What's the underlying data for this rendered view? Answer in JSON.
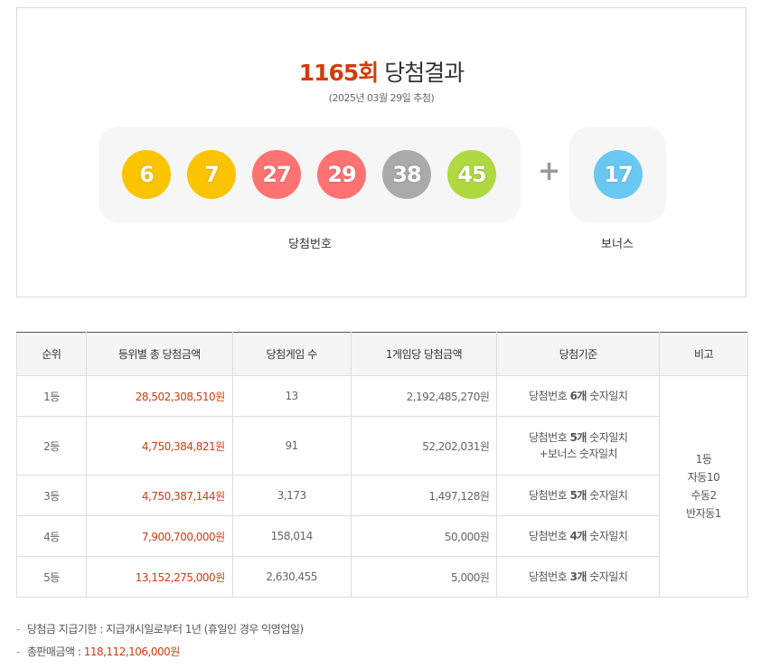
{
  "header": {
    "round": "1165회",
    "title": "당첨결과",
    "date": "(2025년 03월 29일 추첨)"
  },
  "win_numbers": [
    {
      "value": "6",
      "color": "#fbc400"
    },
    {
      "value": "7",
      "color": "#fbc400"
    },
    {
      "value": "27",
      "color": "#ff7272"
    },
    {
      "value": "29",
      "color": "#ff7272"
    },
    {
      "value": "38",
      "color": "#aaaaaa"
    },
    {
      "value": "45",
      "color": "#b0d840"
    }
  ],
  "plus_symbol": "+",
  "bonus_number": {
    "value": "17",
    "color": "#69c8f2"
  },
  "labels": {
    "win_numbers": "당첨번호",
    "bonus": "보너스"
  },
  "table": {
    "headers": [
      "순위",
      "등위별 총 당첨금액",
      "당첨게임 수",
      "1게임당 당첨금액",
      "당첨기준",
      "비고"
    ],
    "rows": [
      {
        "rank": "1등",
        "total": "28,502,308,510원",
        "games": "13",
        "per_game": "2,192,485,270원",
        "criteria_prefix": "당첨번호 ",
        "criteria_bold": "6개",
        "criteria_suffix": " 숫자일치",
        "criteria_line2": ""
      },
      {
        "rank": "2등",
        "total": "4,750,384,821원",
        "games": "91",
        "per_game": "52,202,031원",
        "criteria_prefix": "당첨번호 ",
        "criteria_bold": "5개",
        "criteria_suffix": " 숫자일치",
        "criteria_line2": "+보너스 숫자일치"
      },
      {
        "rank": "3등",
        "total": "4,750,387,144원",
        "games": "3,173",
        "per_game": "1,497,128원",
        "criteria_prefix": "당첨번호 ",
        "criteria_bold": "5개",
        "criteria_suffix": " 숫자일치",
        "criteria_line2": ""
      },
      {
        "rank": "4등",
        "total": "7,900,700,000원",
        "games": "158,014",
        "per_game": "50,000원",
        "criteria_prefix": "당첨번호 ",
        "criteria_bold": "4개",
        "criteria_suffix": " 숫자일치",
        "criteria_line2": ""
      },
      {
        "rank": "5등",
        "total": "13,152,275,000원",
        "games": "2,630,455",
        "per_game": "5,000원",
        "criteria_prefix": "당첨번호 ",
        "criteria_bold": "3개",
        "criteria_suffix": " 숫자일치",
        "criteria_line2": ""
      }
    ],
    "note": [
      "1등",
      "자동10",
      "수동2",
      "반자동1"
    ]
  },
  "footer": {
    "dash": "-",
    "payout_label": "당첨금 지급기한 : 지급개시일로부터 1년 (휴일인 경우 익영업일)",
    "sales_label": "총판매금액 : ",
    "sales_value": "118,112,106,000원"
  }
}
